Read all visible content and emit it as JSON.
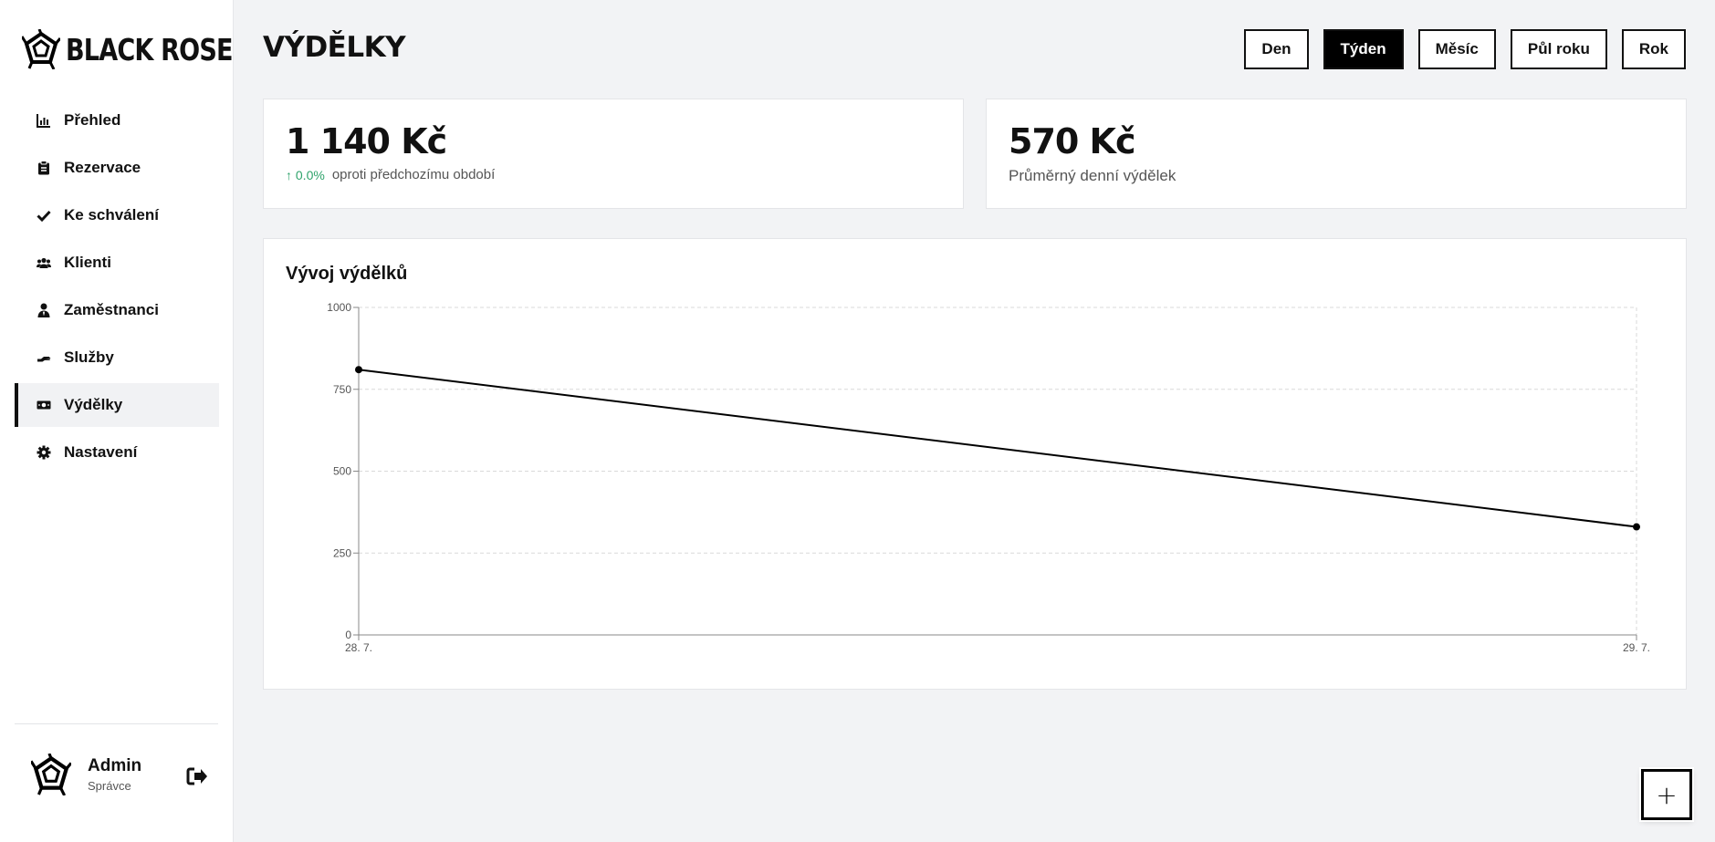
{
  "brand": {
    "name": "BLACK ROSE"
  },
  "nav": {
    "items": [
      {
        "label": "Přehled",
        "icon": "chart-bar-icon"
      },
      {
        "label": "Rezervace",
        "icon": "clipboard-icon"
      },
      {
        "label": "Ke schválení",
        "icon": "check-icon"
      },
      {
        "label": "Klienti",
        "icon": "users-icon"
      },
      {
        "label": "Zaměstnanci",
        "icon": "user-tie-icon"
      },
      {
        "label": "Služby",
        "icon": "hand-icon"
      },
      {
        "label": "Výdělky",
        "icon": "money-icon",
        "active": true
      },
      {
        "label": "Nastavení",
        "icon": "gear-icon"
      }
    ]
  },
  "user": {
    "name": "Admin",
    "role": "Správce"
  },
  "header": {
    "title": "VÝDĚLKY",
    "periods": [
      {
        "label": "Den"
      },
      {
        "label": "Týden",
        "active": true
      },
      {
        "label": "Měsíc"
      },
      {
        "label": "Půl roku"
      },
      {
        "label": "Rok"
      }
    ]
  },
  "stats": {
    "total": {
      "value": "1 140 Kč",
      "change": "↑ 0.0%",
      "change_label": "oproti předchozímu období",
      "change_color": "#2fa36b"
    },
    "average": {
      "value": "570 Kč",
      "label": "Průměrný denní výdělek"
    }
  },
  "chart_title": "Vývoj výdělků",
  "chart_data": {
    "type": "line",
    "x": [
      "28. 7.",
      "29. 7."
    ],
    "series": [
      {
        "values": [
          810,
          330
        ],
        "color": "#000000"
      }
    ],
    "ylim": [
      0,
      1000
    ],
    "yticks": [
      0,
      250,
      500,
      750,
      1000
    ],
    "grid": true
  },
  "fab": {
    "label": "+"
  }
}
